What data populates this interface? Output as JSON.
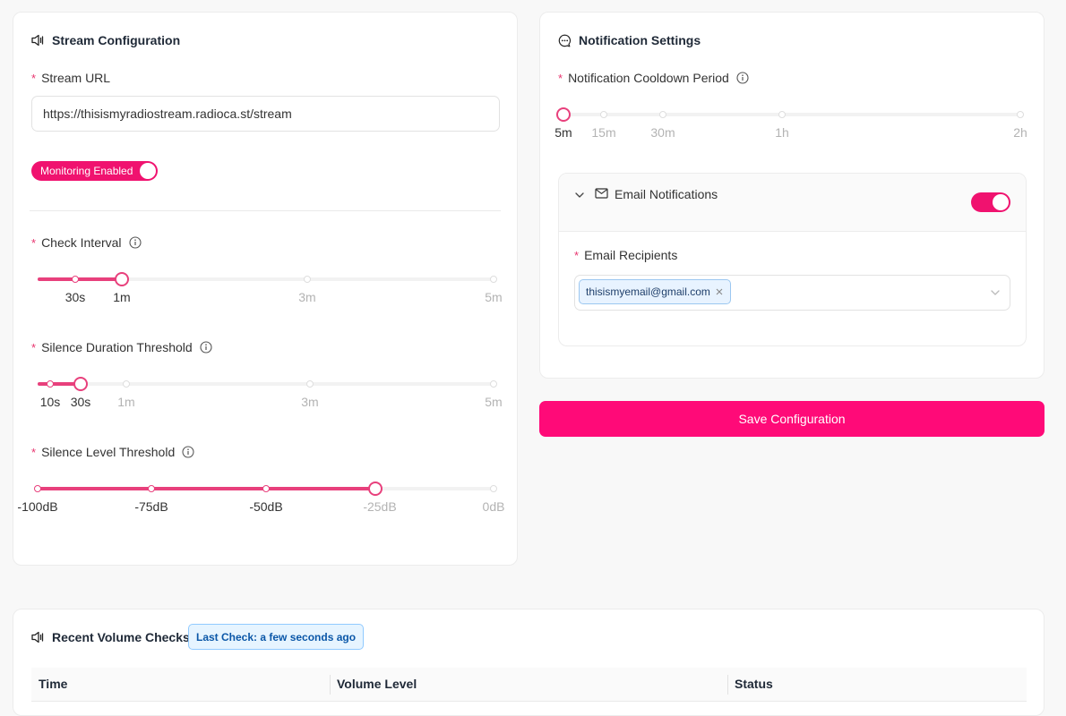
{
  "stream_config": {
    "title": "Stream Configuration",
    "stream_url_label": "Stream URL",
    "stream_url_value": "https://thisismyradiostream.radioca.st/stream",
    "monitoring_label": "Monitoring Enabled",
    "monitoring_enabled": true,
    "check_interval": {
      "label": "Check Interval",
      "value": "1m",
      "marks": [
        "30s",
        "1m",
        "3m",
        "5m"
      ]
    },
    "silence_duration": {
      "label": "Silence Duration Threshold",
      "value": "30s",
      "marks": [
        "10s",
        "30s",
        "1m",
        "3m",
        "5m"
      ]
    },
    "silence_level": {
      "label": "Silence Level Threshold",
      "value": "-25dB",
      "marks": [
        "-100dB",
        "-75dB",
        "-50dB",
        "-25dB",
        "0dB"
      ]
    }
  },
  "notification_settings": {
    "title": "Notification Settings",
    "cooldown": {
      "label": "Notification Cooldown Period",
      "value": "5m",
      "marks": [
        "5m",
        "15m",
        "30m",
        "1h",
        "2h"
      ]
    },
    "email": {
      "title": "Email Notifications",
      "enabled": true,
      "recipients_label": "Email Recipients",
      "recipients": [
        "thisismyemail@gmail.com"
      ]
    }
  },
  "save_button_label": "Save Configuration",
  "recent_checks": {
    "title": "Recent Volume Checks",
    "last_check": "Last Check: a few seconds ago",
    "columns": [
      "Time",
      "Volume Level",
      "Status"
    ]
  },
  "colors": {
    "accent": "#ff0a78",
    "slider": "#e8407c",
    "badge_text": "#0b57a8"
  }
}
